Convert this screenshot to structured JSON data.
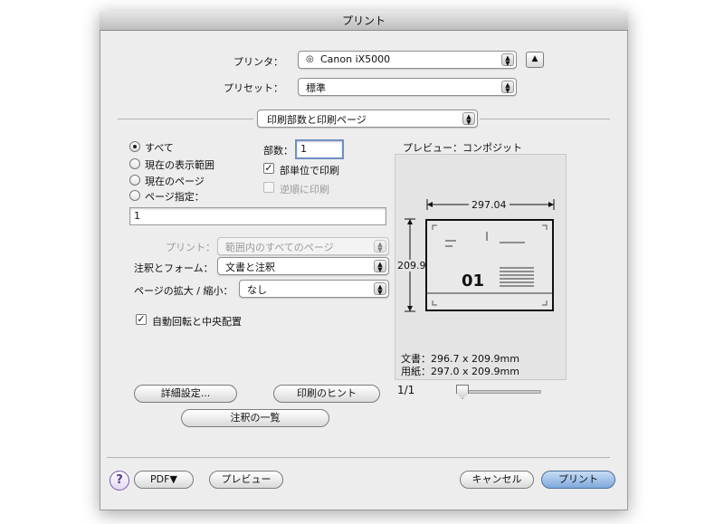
{
  "window": {
    "title": "プリント"
  },
  "printer": {
    "label": "プリンタ：",
    "value": "Canon iX5000"
  },
  "preset": {
    "label": "プリセット：",
    "value": "標準"
  },
  "panel_selector": {
    "value": "印刷部数と印刷ページ"
  },
  "pages": {
    "all": "すべて",
    "current_view": "現在の表示範囲",
    "current_page": "現在のページ",
    "specify": "ページ指定：",
    "range_value": "1",
    "selected": "all"
  },
  "copies": {
    "label": "部数：",
    "value": "1",
    "collate_label": "部単位で印刷",
    "collate_checked": true,
    "reverse_label": "逆順に印刷",
    "reverse_checked": false
  },
  "print_what": {
    "label": "プリント：",
    "value": "範囲内のすべてのページ"
  },
  "comments_forms": {
    "label": "注釈とフォーム：",
    "value": "文書と注釈"
  },
  "page_scaling": {
    "label": "ページの拡大 / 縮小：",
    "value": "なし"
  },
  "auto_rotate": {
    "label": "自動回転と中央配置",
    "checked": true
  },
  "buttons": {
    "advanced": "詳細設定...",
    "print_tips": "印刷のヒント",
    "summarize_comments": "注釈の一覧",
    "pdf": "PDF▼",
    "preview": "プレビュー",
    "cancel": "キャンセル",
    "print": "プリント",
    "help": "?"
  },
  "preview": {
    "title": "プレビュー：コンポジット",
    "width": "297.04",
    "height": "209.9",
    "doc_text": "文書：296.7 x 209.9mm",
    "paper_text": "用紙：297.0 x 209.9mm",
    "page_indicator": "1/1",
    "sample_number": "01",
    "page_slider_fraction": 0.0
  },
  "colors": {
    "primary_button": "#7fa9dc",
    "accent_help": "#5a3a90"
  }
}
